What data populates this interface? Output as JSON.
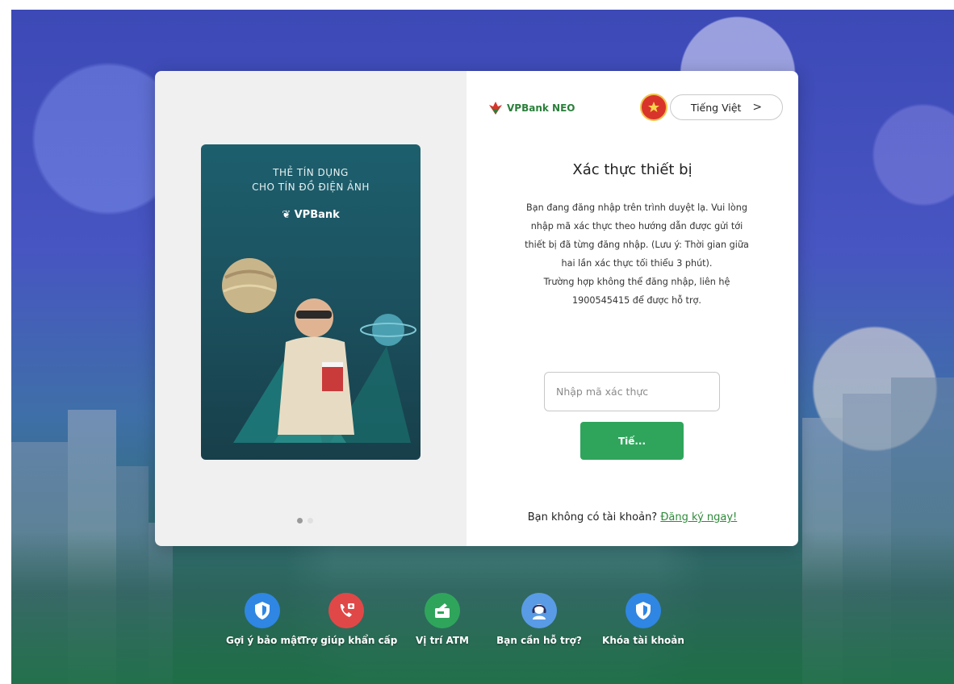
{
  "header": {
    "brand": "VPBank NEO",
    "language_label": "Tiếng Việt"
  },
  "promo": {
    "line1": "THẺ TÍN DỤNG",
    "line2": "CHO TÍN ĐỒ ĐIỆN ẢNH",
    "brand": "VPBank",
    "slides_total": 2,
    "slide_active": 1
  },
  "verify": {
    "title": "Xác thực thiết bị",
    "desc_lines": [
      "Bạn đang đăng nhập trên trình duyệt lạ. Vui lòng",
      "nhập mã xác thực theo hướng dẫn được gửi tới",
      "thiết bị đã từng đăng nhập. (Lưu ý: Thời gian giữa",
      "hai lần xác thực tối thiểu 3 phút).",
      "Trường hợp không thể đăng nhập, liên hệ",
      "1900545415 để được hỗ trợ."
    ],
    "input_placeholder": "Nhập mã xác thực",
    "input_value": "",
    "next_label": "Tiế..."
  },
  "signup": {
    "prompt": "Bạn không có tài khoản?",
    "link": "Đăng ký ngay!"
  },
  "footer": {
    "items": [
      {
        "label": "Gợi ý bảo mật",
        "icon": "shield-icon",
        "color": "#2f86e3"
      },
      {
        "label": "Trợ giúp khẩn cấp",
        "icon": "emergency-call-icon",
        "color": "#e04848"
      },
      {
        "label": "Vị trí ATM",
        "icon": "atm-icon",
        "color": "#2fa55c"
      },
      {
        "label": "Bạn cần hỗ trợ?",
        "icon": "support-agent-icon",
        "color": "#5a9be6"
      },
      {
        "label": "Khóa tài khoản",
        "icon": "shield-icon",
        "color": "#2f86e3"
      }
    ]
  },
  "colors": {
    "accent_green": "#2fa55c",
    "brand_red": "#d9342b",
    "link_green": "#2e8b3a"
  }
}
